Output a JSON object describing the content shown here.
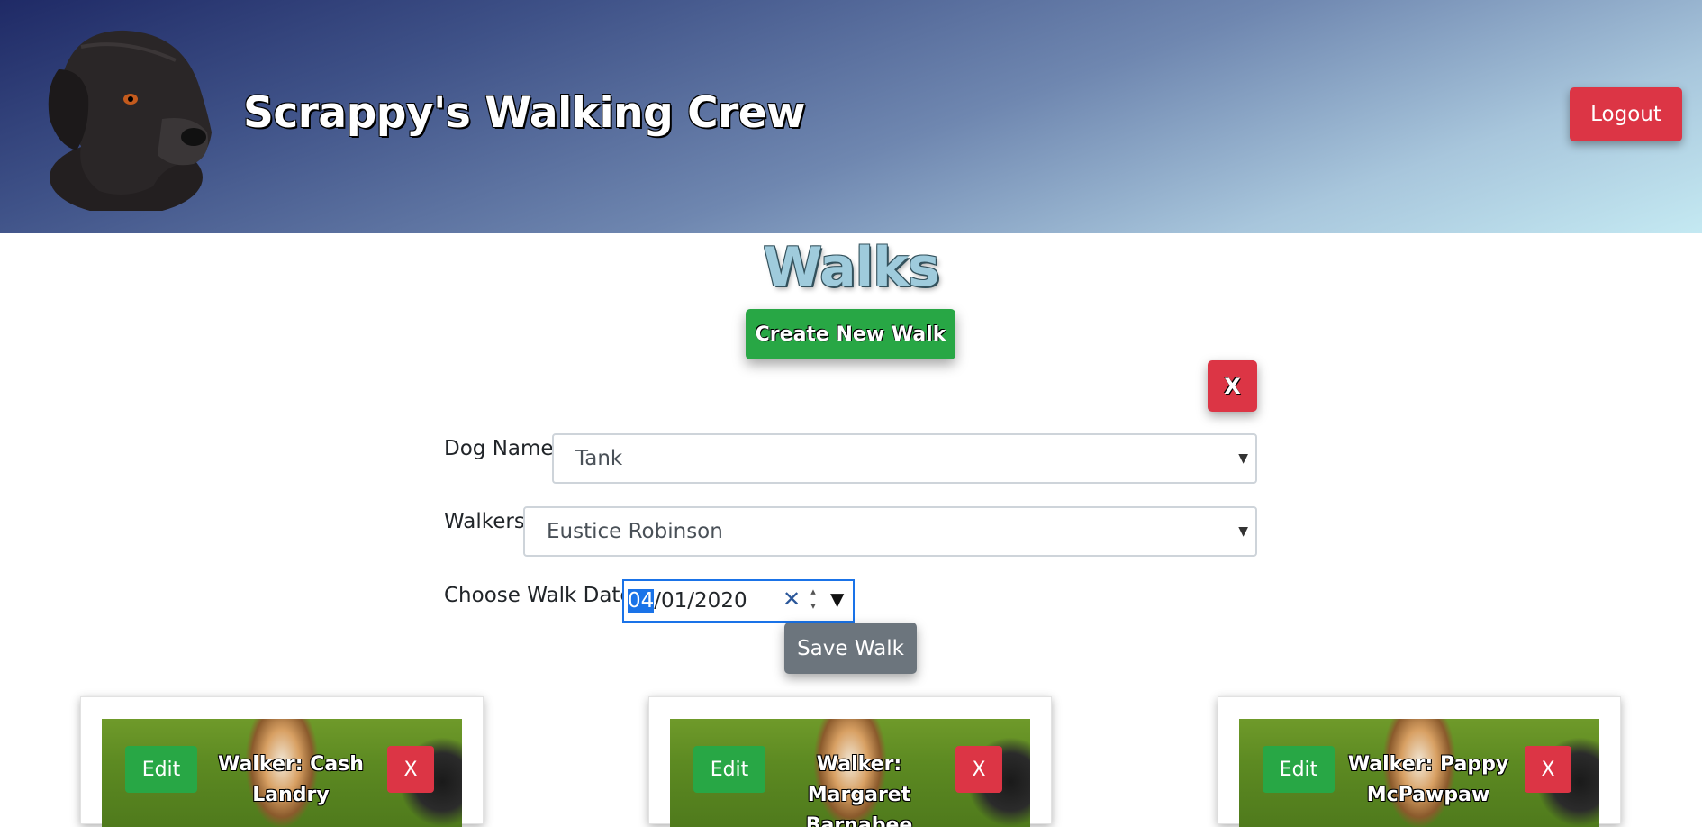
{
  "header": {
    "title": "Scrappy's Walking Crew",
    "logout_label": "Logout"
  },
  "main": {
    "title": "Walks",
    "create_label": "Create New Walk",
    "close_label": "X"
  },
  "form": {
    "dog_label": "Dog Name:",
    "dog_value": "Tank",
    "walker_label": "Walkers:",
    "walker_value": "Eustice Robinson",
    "date_label": "Choose Walk Date:",
    "date_month": "04",
    "date_rest": "/01/2020",
    "save_label": "Save Walk"
  },
  "cards": [
    {
      "title": "Walker: Cash Landry",
      "edit": "Edit",
      "delete": "X"
    },
    {
      "title": "Walker: Margaret Barnabee",
      "edit": "Edit",
      "delete": "X"
    },
    {
      "title": "Walker: Pappy McPawpaw",
      "edit": "Edit",
      "delete": "X"
    }
  ],
  "colors": {
    "danger": "#dc3545",
    "success": "#28a745",
    "secondary": "#6c757d",
    "focus": "#1a73e8"
  }
}
